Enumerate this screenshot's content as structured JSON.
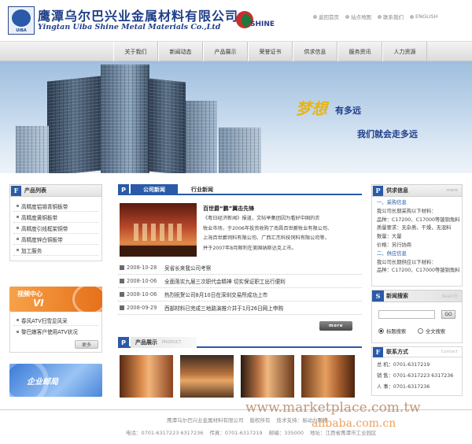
{
  "header": {
    "company_cn": "鹰潭乌尔巴兴业金属材料有限公司",
    "company_en": "Yingtan Uiba Shine Metal Materials Co.,Ltd",
    "logo_sub": "UIBA",
    "partner_logo_text": "SHINE",
    "links": [
      "返回首页",
      "站点地图",
      "联系我们",
      "ENGLISH"
    ]
  },
  "nav": {
    "items": [
      "关于我们",
      "新闻动态",
      "产品展示",
      "荣誉证书",
      "供求信息",
      "服务资讯",
      "人力资源"
    ]
  },
  "banner": {
    "slogan_big": "梦想",
    "slogan_small": "有多远",
    "slogan_line2": "我们就会走多远"
  },
  "left": {
    "products_title": "产品列表",
    "products": [
      "高精度铝锡青铜板带",
      "高精度黄铜板带",
      "高精度引线框架铜带",
      "高精度锌白铜板带",
      "加工服务"
    ],
    "video_title": "视频中心",
    "video_sub": "VI",
    "video_items": [
      "春风ATV扫雪显风采",
      "黎巴嫩客户使用ATV状况"
    ],
    "more_label": "更多",
    "mailbox_title": "企业邮局"
  },
  "center": {
    "tab_company": "公司新闻",
    "tab_industry": "行业新闻",
    "headline": "百世爵“鹏”翼击先锋",
    "headline_body": [
      "《粤日经济新闻》报道，文帖举集团因为看好中国的农",
      "牧业市场，于2006年投资收购了南昌百世爵牧业有限公司、",
      "上海百世爵饲料有限公司、广西汇杰科技饲料有限公司等，",
      "并于2007年8月顺利在美国纳斯达克上市。"
    ],
    "news": [
      {
        "date": "2008-10-28",
        "title": "吴省长来我公司考察"
      },
      {
        "date": "2008-10-06",
        "title": "全面落实九届三次职代会精神 切实保证职工出行便利"
      },
      {
        "date": "2008-10-06",
        "title": "热烈祝贺公司8月10日在深圳交易所成功上市"
      },
      {
        "date": "2008-09-29",
        "title": "西部材料已完成三地路演推介并于1月26日网上申购"
      }
    ],
    "more_label": "more",
    "products_show_title": "产品展示",
    "products_show_en": "PRODUCT"
  },
  "right": {
    "supply_title": "供求信息",
    "supply_more": "more",
    "supply_lines": [
      {
        "text": "一、采购信息",
        "blue": true
      },
      {
        "text": "我公司长期采购以下材料：",
        "blue": false
      },
      {
        "text": "品种：C17200、C17000等铍铜角料",
        "blue": false
      },
      {
        "text": "质量要求：无杂质、干燥，无混料",
        "blue": false
      },
      {
        "text": "数量：大量",
        "blue": false
      },
      {
        "text": "价格：另行协商",
        "blue": false
      },
      {
        "text": "二、供应信息",
        "blue": true
      },
      {
        "text": "我公司长期供应以下材料：",
        "blue": false
      },
      {
        "text": "品种：C17200、C17000等铍铜角料",
        "blue": false
      }
    ],
    "search_title": "新闻搜索",
    "search_en": "Search",
    "search_btn": "GO",
    "radio_title": "标题搜索",
    "radio_content": "全文搜索",
    "contact_title": "联系方式",
    "contact_en": "Contact",
    "contacts": [
      "总 机：0701-6317219",
      "销 售：0701-6317223 6317236",
      "人 事：0701-6317236"
    ]
  },
  "footer": {
    "line1": [
      "鹰潭乌尔巴兴业金属材料有限公司",
      "版权所有",
      "技术支持：易动力网络"
    ],
    "line2": [
      "电话：0701-6317223 6317236",
      "传真：0701-6317219",
      "邮编：335000",
      "地址：江西省鹰潭市工业园区"
    ]
  },
  "watermark": {
    "line1": "www.marketplace.com.tw",
    "line2": "alibaba.com.cn"
  },
  "colors": {
    "brand_blue": "#1e3e88",
    "accent_blue": "#2a5aa8",
    "slogan_gold": "#e8b418",
    "video_orange": "#ec7a1c"
  }
}
